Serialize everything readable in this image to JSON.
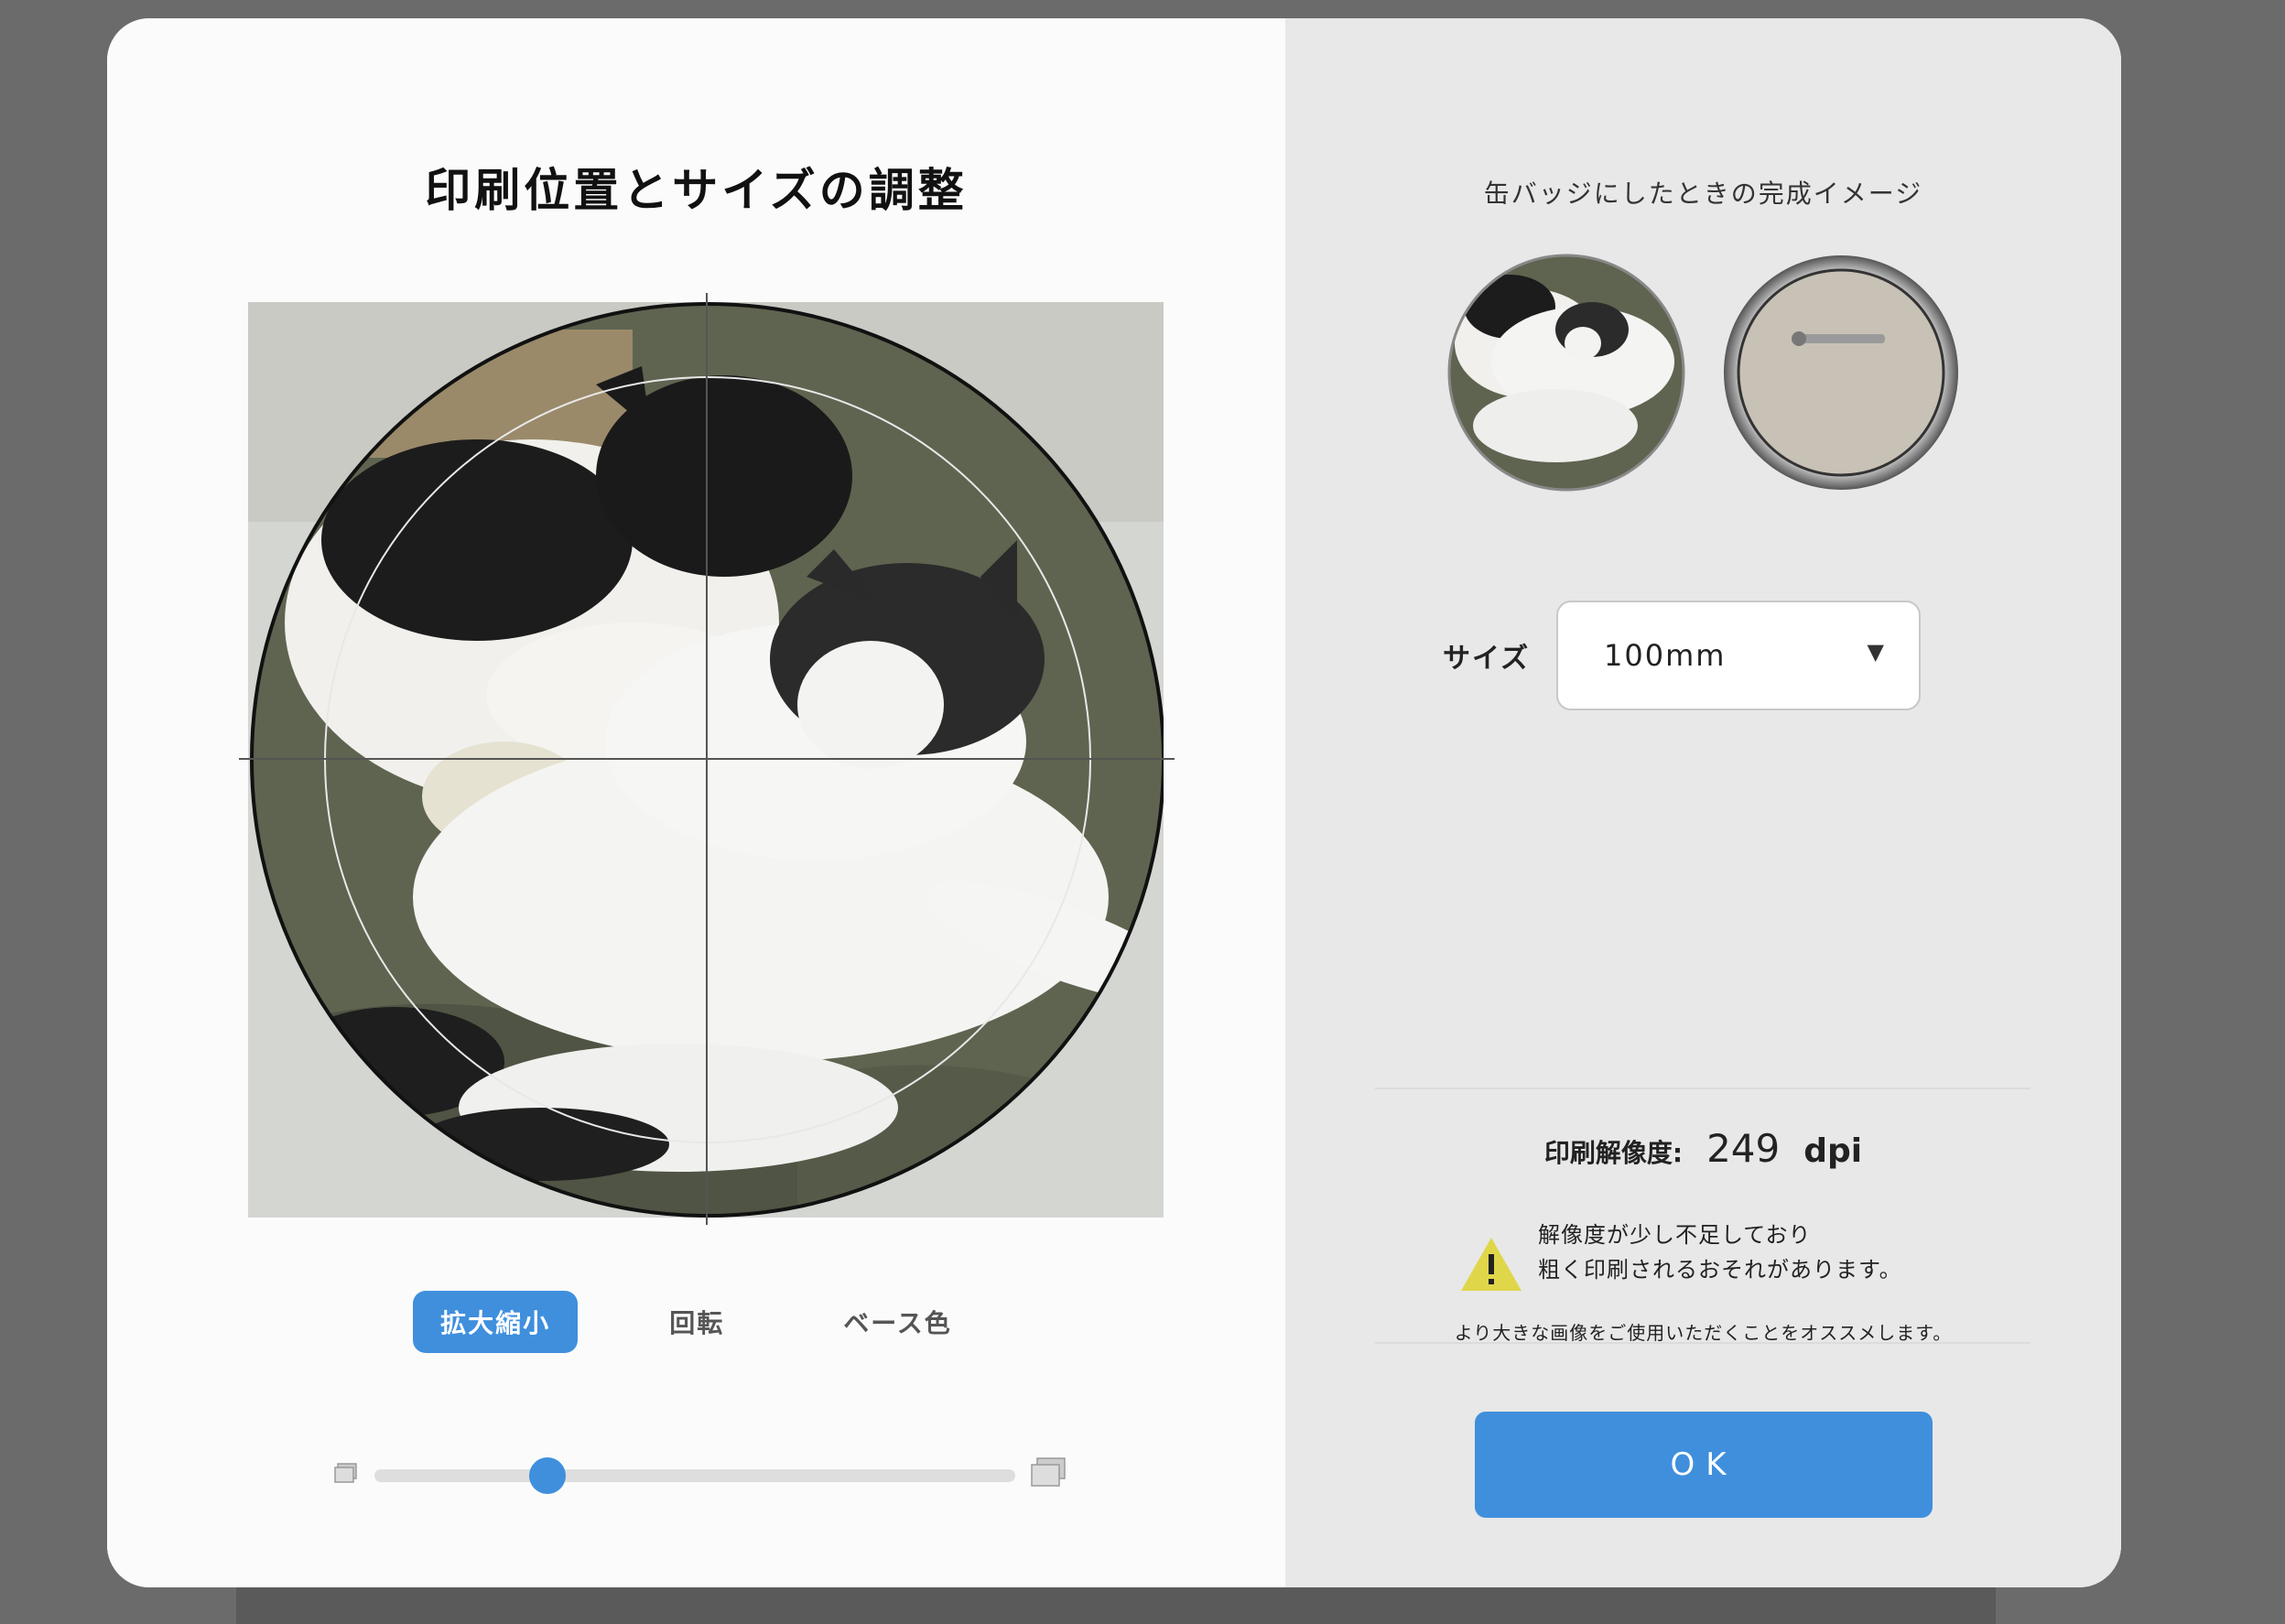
{
  "editor": {
    "title": "印刷位置とサイズの調整",
    "tabs": [
      {
        "label": "拡大縮小",
        "active": true
      },
      {
        "label": "回転",
        "active": false
      },
      {
        "label": "ベース色",
        "active": false
      }
    ],
    "zoom_slider": {
      "value": 0.27
    }
  },
  "preview": {
    "title": "缶バッジにしたときの完成イメージ",
    "size_label": "サイズ",
    "size_value": "100mm",
    "resolution_label": "印刷解像度:",
    "resolution_value": "249",
    "resolution_unit": "dpi",
    "warning_line1": "解像度が少し不足しており",
    "warning_line2": "粗く印刷されるおそれがあります。",
    "hint": "より大きな画像をご使用いただくことをオススメします。",
    "ok_label": "OK"
  },
  "colors": {
    "accent": "#3f8fdd",
    "warning": "#e0d64a",
    "backdrop": "#6b6b6b"
  }
}
